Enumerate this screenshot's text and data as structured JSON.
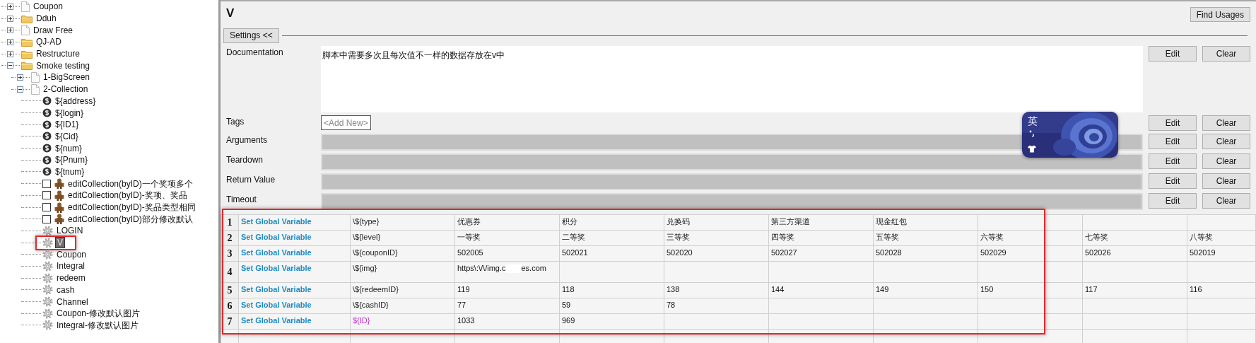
{
  "tree": {
    "items": [
      {
        "label": "Coupon",
        "kind": "file",
        "expanded": false,
        "selected": false
      },
      {
        "label": "Dduh",
        "kind": "folder",
        "expanded": false,
        "selected": false
      },
      {
        "label": "Draw Free",
        "kind": "file",
        "expanded": false,
        "selected": false
      },
      {
        "label": "QJ-AD",
        "kind": "folder",
        "expanded": false,
        "selected": false
      },
      {
        "label": "Restructure",
        "kind": "folder",
        "expanded": false,
        "selected": false
      },
      {
        "label": "Smoke testing",
        "kind": "folder",
        "expanded": true,
        "selected": false,
        "children": [
          {
            "label": "1-BigScreen",
            "kind": "file",
            "expanded": false,
            "selected": false
          },
          {
            "label": "2-Collection",
            "kind": "file",
            "expanded": true,
            "selected": false,
            "children": [
              {
                "label": "${address}",
                "kind": "variable",
                "selected": false
              },
              {
                "label": "${login}",
                "kind": "variable",
                "selected": false
              },
              {
                "label": "${ID1}",
                "kind": "variable",
                "selected": false
              },
              {
                "label": "${Cid}",
                "kind": "variable",
                "selected": false
              },
              {
                "label": "${num}",
                "kind": "variable",
                "selected": false
              },
              {
                "label": "${Pnum}",
                "kind": "variable",
                "selected": false
              },
              {
                "label": "${tnum}",
                "kind": "variable",
                "selected": false
              },
              {
                "label": "editCollection(byID)一个奖项多个",
                "kind": "test",
                "checked": false,
                "selected": false
              },
              {
                "label": "editCollection(byID)-奖项、奖品",
                "kind": "test",
                "checked": false,
                "selected": false
              },
              {
                "label": "editCollection(byID)-奖品类型相同",
                "kind": "test",
                "checked": false,
                "selected": false
              },
              {
                "label": "editCollection(byID)部分修改默认",
                "kind": "test",
                "checked": false,
                "selected": false
              },
              {
                "label": "LOGIN",
                "kind": "keyword",
                "selected": false
              },
              {
                "label": "V",
                "kind": "keyword",
                "selected": true
              },
              {
                "label": "Coupon",
                "kind": "keyword",
                "selected": false
              },
              {
                "label": "Integral",
                "kind": "keyword",
                "selected": false
              },
              {
                "label": "redeem",
                "kind": "keyword",
                "selected": false
              },
              {
                "label": "cash",
                "kind": "keyword",
                "selected": false
              },
              {
                "label": "Channel",
                "kind": "keyword",
                "selected": false
              },
              {
                "label": "Coupon-修改默认图片",
                "kind": "keyword",
                "selected": false
              },
              {
                "label": "Integral-修改默认图片",
                "kind": "keyword",
                "selected": false
              }
            ]
          }
        ]
      }
    ]
  },
  "editor": {
    "title": "V",
    "find_usages": "Find Usages",
    "settings_toggle": "Settings <<",
    "settings": [
      {
        "label": "Documentation",
        "kind": "doc",
        "value": "脚本中需要多次且每次值不一样的数据存放在v中",
        "buttons": [
          "Edit",
          "Clear"
        ]
      },
      {
        "label": "Tags",
        "kind": "tags",
        "placeholder": "<Add New>",
        "buttons": [
          "Edit",
          "Clear"
        ]
      },
      {
        "label": "Arguments",
        "kind": "field",
        "buttons": [
          "Edit",
          "Clear"
        ]
      },
      {
        "label": "Teardown",
        "kind": "field",
        "buttons": [
          "Edit",
          "Clear"
        ]
      },
      {
        "label": "Return Value",
        "kind": "field",
        "buttons": [
          "Edit",
          "Clear"
        ]
      },
      {
        "label": "Timeout",
        "kind": "field",
        "buttons": [
          "Edit",
          "Clear"
        ]
      }
    ]
  },
  "ime_indicator": {
    "language": "英"
  },
  "table": {
    "rows": [
      {
        "number": "1",
        "keyword": "Set Global Variable",
        "argument": {
          "text": "\\${type}",
          "kind": "escaped"
        },
        "cells": [
          "优惠券",
          "积分",
          "兑换码",
          "第三方渠道",
          "现金红包",
          null,
          null,
          null
        ]
      },
      {
        "number": "2",
        "keyword": "Set Global Variable",
        "argument": {
          "text": "\\${level}",
          "kind": "escaped"
        },
        "cells": [
          "一等奖",
          "二等奖",
          "三等奖",
          "四等奖",
          "五等奖",
          "六等奖",
          "七等奖",
          "八等奖"
        ]
      },
      {
        "number": "3",
        "keyword": "Set Global Variable",
        "argument": {
          "text": "\\${couponID}",
          "kind": "escaped"
        },
        "cells": [
          "502005",
          "502021",
          "502020",
          "502027",
          "502028",
          "502029",
          "502026",
          "502019"
        ]
      },
      {
        "number": "4",
        "keyword": "Set Global Variable",
        "argument": {
          "text": "\\${img}",
          "kind": "escaped"
        },
        "tall": true,
        "cells": [
          {
            "kind": "redacted",
            "parts": [
              "https\\:\\/\\/img.c",
              "es.com"
            ]
          },
          null,
          null,
          null,
          null,
          null,
          null,
          null
        ]
      },
      {
        "number": "5",
        "keyword": "Set Global Variable",
        "argument": {
          "text": "\\${redeemID}",
          "kind": "escaped"
        },
        "cells": [
          "119",
          "118",
          "138",
          "144",
          "149",
          "150",
          "117",
          "116"
        ]
      },
      {
        "number": "6",
        "keyword": "Set Global Variable",
        "argument": {
          "text": "\\${cashID}",
          "kind": "escaped"
        },
        "cells": [
          "77",
          "59",
          "78",
          null,
          null,
          null,
          null,
          null
        ]
      },
      {
        "number": "7",
        "keyword": "Set Global Variable",
        "argument": {
          "text": "${ID}",
          "kind": "variable"
        },
        "cells": [
          "1033",
          "969",
          null,
          null,
          null,
          null,
          null,
          null
        ]
      }
    ]
  }
}
